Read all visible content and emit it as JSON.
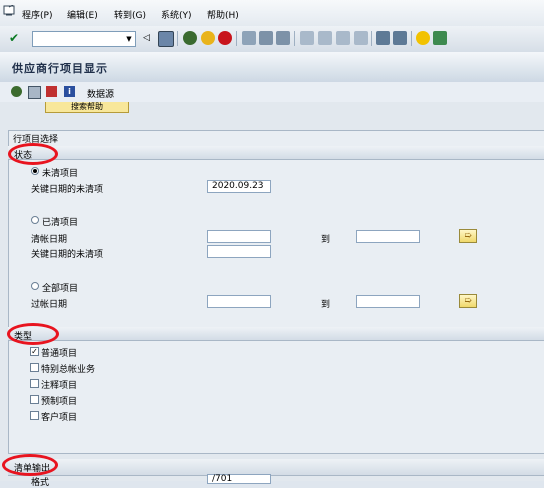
{
  "menu": {
    "items": [
      "程序(P)",
      "编辑(E)",
      "转到(G)",
      "系统(Y)",
      "帮助(H)"
    ]
  },
  "toolbar": {
    "command_field": ""
  },
  "title": "供应商行项目显示",
  "app_toolbar": {
    "data_source": "数据源"
  },
  "search_help_button": "搜索帮助",
  "sections": {
    "line_item_selection": "行项目选择",
    "status": "状态",
    "type": "类型",
    "list_output": "清单输出"
  },
  "status": {
    "open_items": "未清项目",
    "open_at_key_date": "关键日期的未清项",
    "open_at_key_date_value": "2020.09.23",
    "cleared_items": "已清项目",
    "clearing_date": "清帐日期",
    "to": "到",
    "cleared_open_at_key_date": "关键日期的未清项",
    "all_items": "全部项目",
    "posting_date": "过帐日期"
  },
  "type": {
    "normal_items": "普通项目",
    "special_gl": "特别总帐业务",
    "noted_items": "注释项目",
    "parked_items": "预制项目",
    "customer_items": "客户项目"
  },
  "list_output": {
    "layout_label": "格式",
    "layout_value": "/701"
  }
}
